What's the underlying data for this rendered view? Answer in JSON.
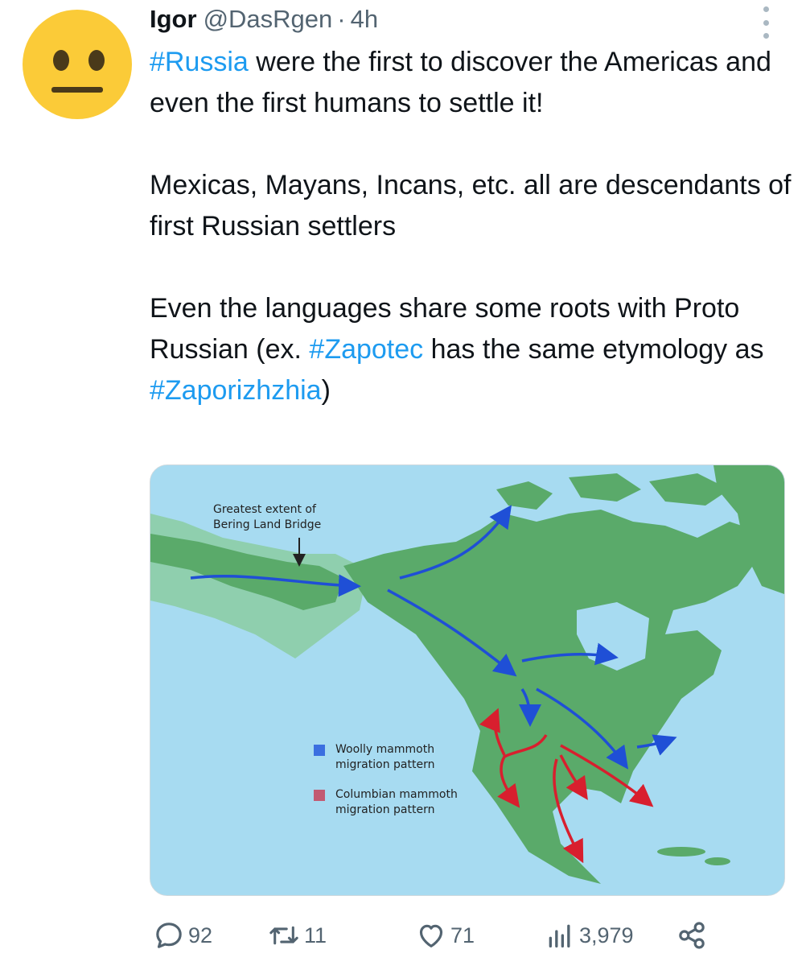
{
  "tweet": {
    "display_name": "Igor",
    "handle": "@DasRgen",
    "separator": "·",
    "time": "4h",
    "line1_hashtag": "#Russia",
    "line1_rest": " were the first to discover the Americas and even the first humans to settle it!",
    "paragraph2": "Mexicas, Mayans, Incans, etc. all are descendants of first Russian settlers",
    "para3_a": "Even the languages share some roots with Proto Russian (ex. ",
    "para3_hashtag1": "#Zapotec",
    "para3_b": " has the same etymology as ",
    "para3_hashtag2": "#Zaporizhzhia",
    "para3_c": ")"
  },
  "map": {
    "bering_label_line1": "Greatest extent of",
    "bering_label_line2": "Bering Land Bridge",
    "legend_woolly_line1": "Woolly mammoth",
    "legend_woolly_line2": "migration pattern",
    "legend_columbian_line1": "Columbian mammoth",
    "legend_columbian_line2": "migration pattern",
    "colors": {
      "ocean": "#a7dbf1",
      "land": "#5aaa6a",
      "land_bridge": "#8fcfae",
      "woolly_arrow": "#1f4fd6",
      "columbian_arrow": "#d81f2e",
      "woolly_legend": "#3b6fe0",
      "columbian_legend": "#c25a72"
    }
  },
  "actions": {
    "replies": "92",
    "retweets": "11",
    "likes": "71",
    "views": "3,979"
  },
  "icons": [
    "more-icon",
    "reply-icon",
    "retweet-icon",
    "like-icon",
    "views-icon",
    "share-icon"
  ]
}
